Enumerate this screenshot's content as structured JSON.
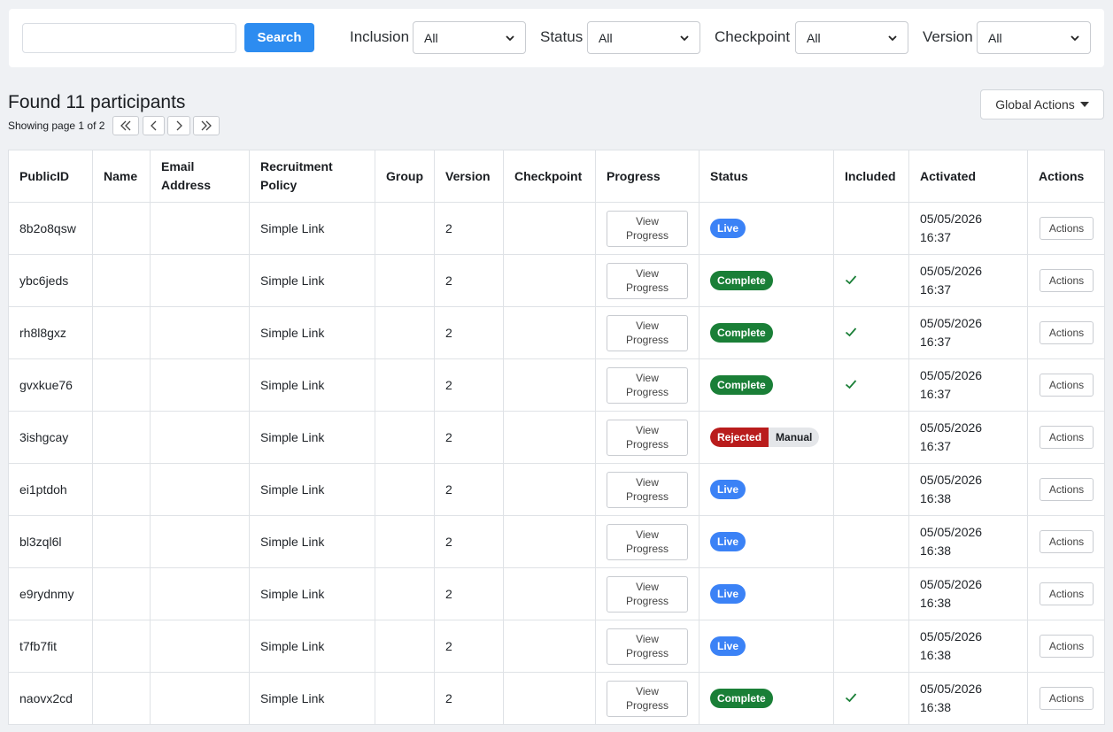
{
  "filters": {
    "search_value": "",
    "search_button": "Search",
    "inclusion": {
      "label": "Inclusion",
      "value": "All"
    },
    "status": {
      "label": "Status",
      "value": "All"
    },
    "checkpoint": {
      "label": "Checkpoint",
      "value": "All"
    },
    "version": {
      "label": "Version",
      "value": "All"
    }
  },
  "summary": {
    "found": "Found 11 participants",
    "showing": "Showing page 1 of 2"
  },
  "global_actions": "Global Actions",
  "table": {
    "headers": [
      "PublicID",
      "Name",
      "Email Address",
      "Recruitment Policy",
      "Group",
      "Version",
      "Checkpoint",
      "Progress",
      "Status",
      "Included",
      "Activated",
      "Actions"
    ],
    "view_progress": "View Progress",
    "actions_label": "Actions",
    "rows": [
      {
        "public_id": "8b2o8qsw",
        "name": "",
        "email": "",
        "policy": "Simple Link",
        "group": "",
        "version": "2",
        "checkpoint": "",
        "status": [
          "Live"
        ],
        "included": false,
        "date": "05/05/2026",
        "time": "16:37"
      },
      {
        "public_id": "ybc6jeds",
        "name": "",
        "email": "",
        "policy": "Simple Link",
        "group": "",
        "version": "2",
        "checkpoint": "",
        "status": [
          "Complete"
        ],
        "included": true,
        "date": "05/05/2026",
        "time": "16:37"
      },
      {
        "public_id": "rh8l8gxz",
        "name": "",
        "email": "",
        "policy": "Simple Link",
        "group": "",
        "version": "2",
        "checkpoint": "",
        "status": [
          "Complete"
        ],
        "included": true,
        "date": "05/05/2026",
        "time": "16:37"
      },
      {
        "public_id": "gvxkue76",
        "name": "",
        "email": "",
        "policy": "Simple Link",
        "group": "",
        "version": "2",
        "checkpoint": "",
        "status": [
          "Complete"
        ],
        "included": true,
        "date": "05/05/2026",
        "time": "16:37"
      },
      {
        "public_id": "3ishgcay",
        "name": "",
        "email": "",
        "policy": "Simple Link",
        "group": "",
        "version": "2",
        "checkpoint": "",
        "status": [
          "Rejected",
          "Manual"
        ],
        "included": false,
        "date": "05/05/2026",
        "time": "16:37"
      },
      {
        "public_id": "ei1ptdoh",
        "name": "",
        "email": "",
        "policy": "Simple Link",
        "group": "",
        "version": "2",
        "checkpoint": "",
        "status": [
          "Live"
        ],
        "included": false,
        "date": "05/05/2026",
        "time": "16:38"
      },
      {
        "public_id": "bl3zql6l",
        "name": "",
        "email": "",
        "policy": "Simple Link",
        "group": "",
        "version": "2",
        "checkpoint": "",
        "status": [
          "Live"
        ],
        "included": false,
        "date": "05/05/2026",
        "time": "16:38"
      },
      {
        "public_id": "e9rydnmy",
        "name": "",
        "email": "",
        "policy": "Simple Link",
        "group": "",
        "version": "2",
        "checkpoint": "",
        "status": [
          "Live"
        ],
        "included": false,
        "date": "05/05/2026",
        "time": "16:38"
      },
      {
        "public_id": "t7fb7fit",
        "name": "",
        "email": "",
        "policy": "Simple Link",
        "group": "",
        "version": "2",
        "checkpoint": "",
        "status": [
          "Live"
        ],
        "included": false,
        "date": "05/05/2026",
        "time": "16:38"
      },
      {
        "public_id": "naovx2cd",
        "name": "",
        "email": "",
        "policy": "Simple Link",
        "group": "",
        "version": "2",
        "checkpoint": "",
        "status": [
          "Complete"
        ],
        "included": true,
        "date": "05/05/2026",
        "time": "16:38"
      }
    ]
  },
  "colors": {
    "primary": "#2d8cf0",
    "live": "#3b82f6",
    "complete": "#1a7f37",
    "rejected": "#b91c1c",
    "manual": "#e4e6e9",
    "check": "#1a7f37"
  }
}
